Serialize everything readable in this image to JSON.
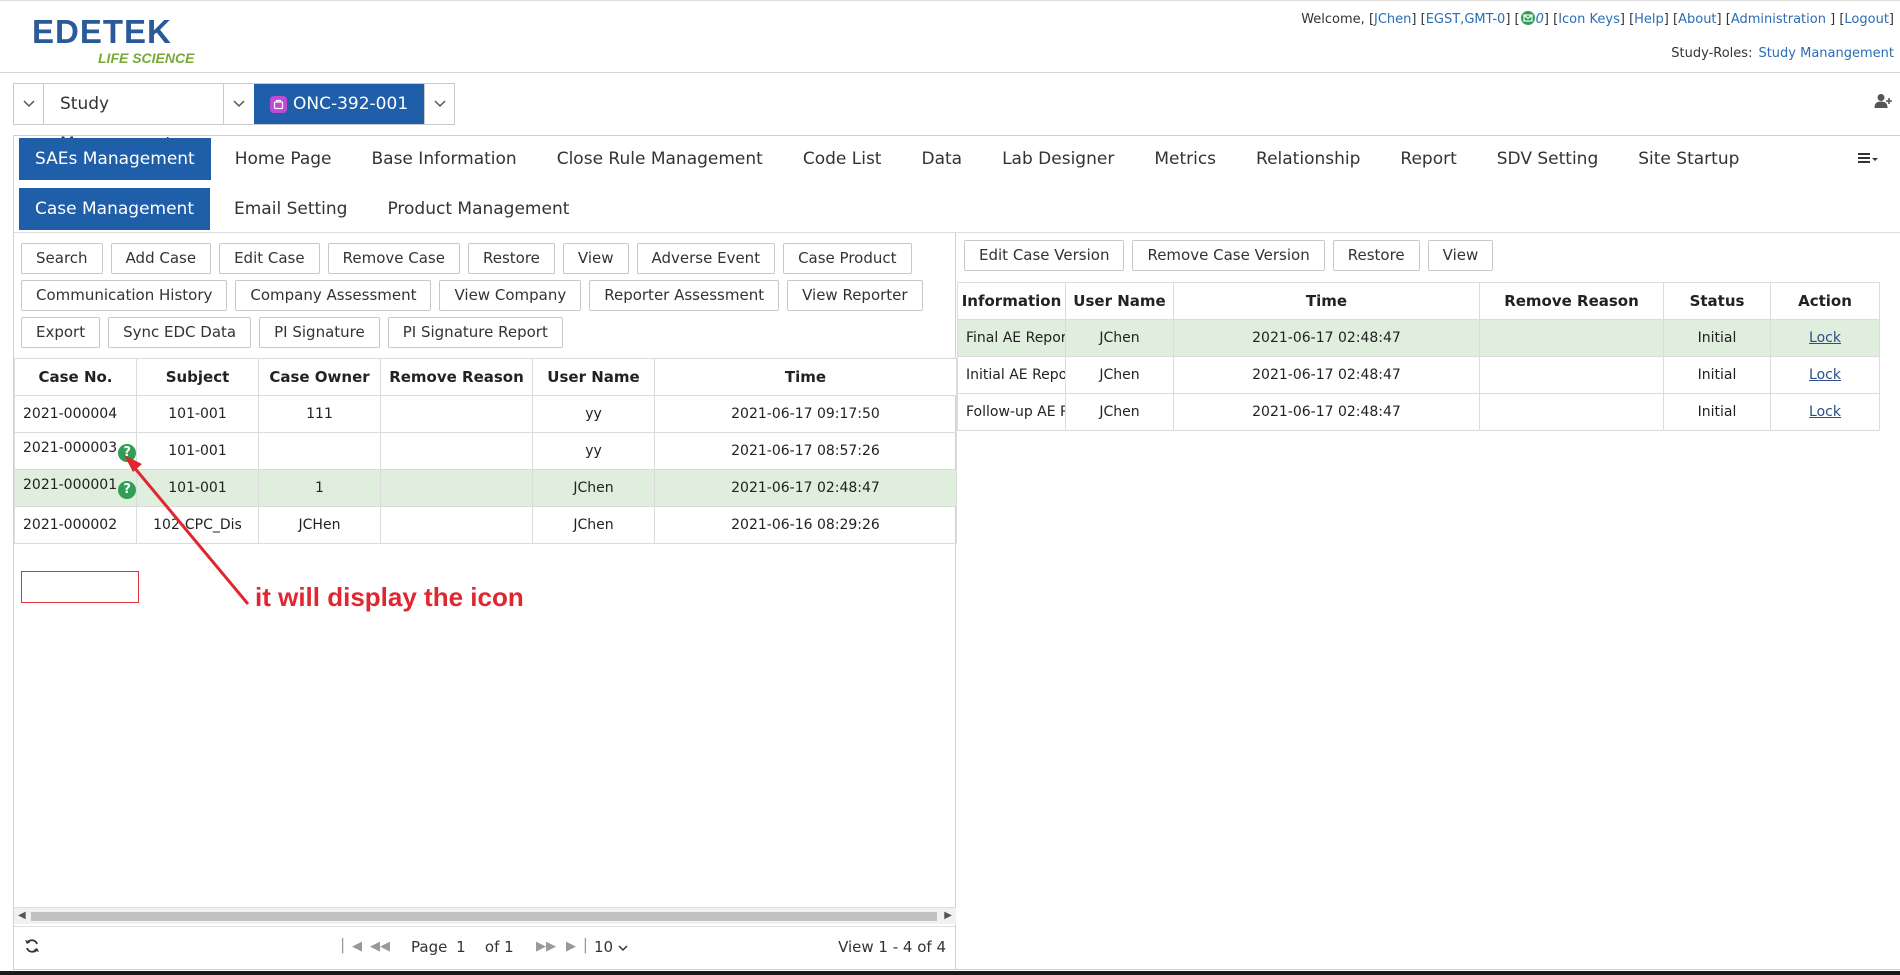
{
  "header": {
    "logo_text": "EDETEK",
    "logo_sub": "LIFE SCIENCE",
    "welcome_prefix": "Welcome,",
    "user": "JChen",
    "timezone": "EGST,GMT-0",
    "mail_count": "0",
    "links": [
      "Icon Keys",
      "Help",
      "About",
      "Administration",
      "Logout"
    ],
    "roles_label": "Study-Roles:",
    "roles_value": "Study Manangement"
  },
  "selector": {
    "module": "Study Management",
    "study": "ONC-392-001"
  },
  "tabs_primary": [
    "SAEs Management",
    "Home Page",
    "Base Information",
    "Close Rule Management",
    "Code List",
    "Data",
    "Lab Designer",
    "Metrics",
    "Relationship",
    "Report",
    "SDV Setting",
    "Site Startup"
  ],
  "tabs_secondary": [
    "Case Management",
    "Email Setting",
    "Product Management"
  ],
  "left_buttons": [
    "Search",
    "Add Case",
    "Edit Case",
    "Remove Case",
    "Restore",
    "View",
    "Adverse Event",
    "Case Product",
    "Communication History",
    "Company Assessment",
    "View Company",
    "Reporter Assessment",
    "View Reporter",
    "Export",
    "Sync EDC Data",
    "PI Signature",
    "PI Signature Report"
  ],
  "left_table": {
    "columns": [
      "Case No.",
      "Subject",
      "Case Owner",
      "Remove Reason",
      "User Name",
      "Time"
    ],
    "rows": [
      {
        "case_no": "2021-000004",
        "subject": "101-001",
        "owner": "111",
        "reason": "",
        "user": "yy",
        "time": "2021-06-17 09:17:50",
        "icon": false
      },
      {
        "case_no": "2021-000003",
        "subject": "101-001",
        "owner": "",
        "reason": "",
        "user": "yy",
        "time": "2021-06-17 08:57:26",
        "icon": true
      },
      {
        "case_no": "2021-000001",
        "subject": "101-001",
        "owner": "1",
        "reason": "",
        "user": "JChen",
        "time": "2021-06-17 02:48:47",
        "icon": true
      },
      {
        "case_no": "2021-000002",
        "subject": "102-CPC_Dis",
        "owner": "JCHen",
        "reason": "",
        "user": "JChen",
        "time": "2021-06-16 08:29:26",
        "icon": false
      }
    ]
  },
  "pager": {
    "page_label": "Page",
    "page_value": "1",
    "of_label": "of 1",
    "page_size": "10",
    "view_text": "View 1 - 4 of 4"
  },
  "right_buttons": [
    "Edit Case Version",
    "Remove Case Version",
    "Restore",
    "View"
  ],
  "right_table": {
    "columns": [
      "Information",
      "User Name",
      "Time",
      "Remove Reason",
      "Status",
      "Action"
    ],
    "rows": [
      {
        "info": "Final AE Report",
        "user": "JChen",
        "time": "2021-06-17 02:48:47",
        "reason": "",
        "status": "Initial",
        "action": "Lock"
      },
      {
        "info": "Initial AE Report",
        "user": "JChen",
        "time": "2021-06-17 02:48:47",
        "reason": "",
        "status": "Initial",
        "action": "Lock"
      },
      {
        "info": "Follow-up AE Report",
        "user": "JChen",
        "time": "2021-06-17 02:48:47",
        "reason": "",
        "status": "Initial",
        "action": "Lock"
      }
    ]
  },
  "annotation": {
    "text": "it will display the icon",
    "color": "#e0262f"
  },
  "colors": {
    "primary": "#1f5ea8",
    "row_highlight": "#dfeedd",
    "icon_green": "#2e9f55",
    "link": "#2a6db5"
  }
}
